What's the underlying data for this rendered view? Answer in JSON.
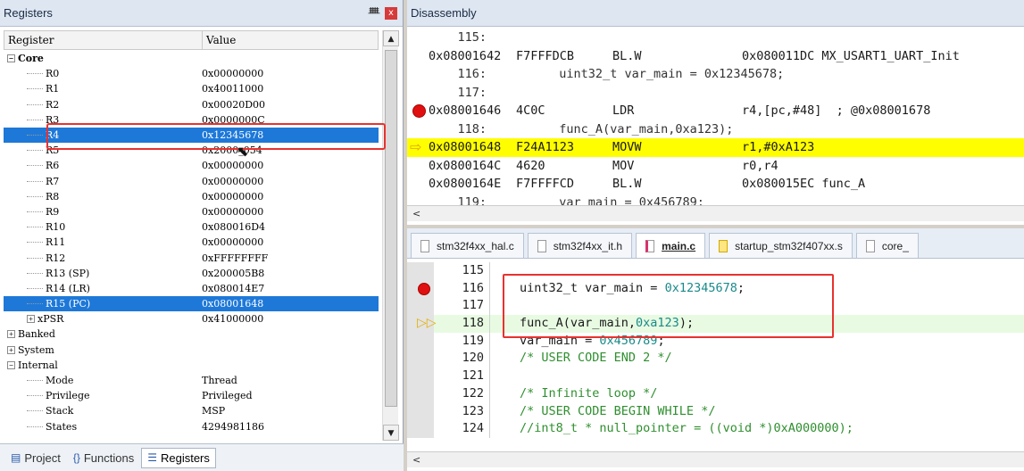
{
  "registers_pane": {
    "title": "Registers",
    "pin_glyph": "ᚙ",
    "close_glyph": "x",
    "col_register": "Register",
    "col_value": "Value",
    "rows": [
      {
        "name": "Core",
        "value": "",
        "level": 0,
        "expander": "−",
        "bold": true
      },
      {
        "name": "R0",
        "value": "0x00000000",
        "level": 1
      },
      {
        "name": "R1",
        "value": "0x40011000",
        "level": 1
      },
      {
        "name": "R2",
        "value": "0x00020D00",
        "level": 1
      },
      {
        "name": "R3",
        "value": "0x0000000C",
        "level": 1
      },
      {
        "name": "R4",
        "value": "0x12345678",
        "level": 1,
        "selected": true
      },
      {
        "name": "R5",
        "value": "0x2000_054",
        "level": 1
      },
      {
        "name": "R6",
        "value": "0x00000000",
        "level": 1
      },
      {
        "name": "R7",
        "value": "0x00000000",
        "level": 1
      },
      {
        "name": "R8",
        "value": "0x00000000",
        "level": 1
      },
      {
        "name": "R9",
        "value": "0x00000000",
        "level": 1
      },
      {
        "name": "R10",
        "value": "0x080016D4",
        "level": 1
      },
      {
        "name": "R11",
        "value": "0x00000000",
        "level": 1
      },
      {
        "name": "R12",
        "value": "0xFFFFFFFF",
        "level": 1
      },
      {
        "name": "R13 (SP)",
        "value": "0x200005B8",
        "level": 1
      },
      {
        "name": "R14 (LR)",
        "value": "0x080014E7",
        "level": 1
      },
      {
        "name": "R15 (PC)",
        "value": "0x08001648",
        "level": 1,
        "selected": true
      },
      {
        "name": "xPSR",
        "value": "0x41000000",
        "level": 1,
        "expander": "+"
      },
      {
        "name": "Banked",
        "value": "",
        "level": 0,
        "expander": "+"
      },
      {
        "name": "System",
        "value": "",
        "level": 0,
        "expander": "+"
      },
      {
        "name": "Internal",
        "value": "",
        "level": 0,
        "expander": "−"
      },
      {
        "name": "Mode",
        "value": "Thread",
        "level": 1
      },
      {
        "name": "Privilege",
        "value": "Privileged",
        "level": 1
      },
      {
        "name": "Stack",
        "value": "MSP",
        "level": 1
      },
      {
        "name": "States",
        "value": "4294981186",
        "level": 1
      }
    ],
    "bottom_tabs": [
      {
        "label": "Project",
        "icon": "▤"
      },
      {
        "label": "Functions",
        "icon": "{}"
      },
      {
        "label": "Registers",
        "icon": "☰",
        "active": true
      }
    ],
    "scroll_up": "▲",
    "scroll_down": "▼"
  },
  "disassembly_pane": {
    "title": "Disassembly",
    "lines": [
      {
        "kind": "src",
        "text": "    115:"
      },
      {
        "kind": "asm",
        "addr": "0x08001642",
        "op": "F7FFFDCB",
        "mn": "BL.W",
        "args": "0x080011DC MX_USART1_UART_Init"
      },
      {
        "kind": "src",
        "text": "    116:          uint32_t var_main = 0x12345678;"
      },
      {
        "kind": "src",
        "text": "    117:"
      },
      {
        "kind": "asm",
        "addr": "0x08001646",
        "op": "4C0C",
        "mn": "LDR",
        "args": "r4,[pc,#48]  ; @0x08001678",
        "breakpoint": true
      },
      {
        "kind": "src",
        "text": "    118:          func_A(var_main,0xa123);"
      },
      {
        "kind": "asm",
        "addr": "0x08001648",
        "op": "F24A1123",
        "mn": "MOVW",
        "args": "r1,#0xA123",
        "current": true
      },
      {
        "kind": "asm",
        "addr": "0x0800164C",
        "op": "4620",
        "mn": "MOV",
        "args": "r0,r4"
      },
      {
        "kind": "asm",
        "addr": "0x0800164E",
        "op": "F7FFFFCD",
        "mn": "BL.W",
        "args": "0x080015EC func_A"
      },
      {
        "kind": "src",
        "text": "    119:          var_main = 0x456789;"
      }
    ],
    "scroll_left": "<"
  },
  "editor": {
    "tabs": [
      {
        "label": "stm32f4xx_hal.c",
        "mark": ""
      },
      {
        "label": "stm32f4xx_it.h",
        "mark": ""
      },
      {
        "label": "main.c",
        "mark": "m",
        "active": true
      },
      {
        "label": "startup_stm32f407xx.s",
        "mark": "y"
      },
      {
        "label": "core_",
        "mark": ""
      }
    ],
    "lines": [
      {
        "no": "115",
        "text": ""
      },
      {
        "no": "116",
        "text": "uint32_t var_main = 0x12345678;",
        "breakpoint": true
      },
      {
        "no": "117",
        "text": ""
      },
      {
        "no": "118",
        "text": "func_A(var_main,0xa123);",
        "current": true
      },
      {
        "no": "119",
        "text": "var_main = 0x456789;"
      },
      {
        "no": "120",
        "text": "/* USER CODE END 2 */",
        "comment": true
      },
      {
        "no": "121",
        "text": ""
      },
      {
        "no": "122",
        "text": "/* Infinite loop */",
        "comment": true
      },
      {
        "no": "123",
        "text": "/* USER CODE BEGIN WHILE */",
        "comment": true
      },
      {
        "no": "124",
        "text": "//int8_t * null_pointer = ((void *)0xA000000);",
        "comment": true
      }
    ],
    "scroll_left": "<"
  }
}
